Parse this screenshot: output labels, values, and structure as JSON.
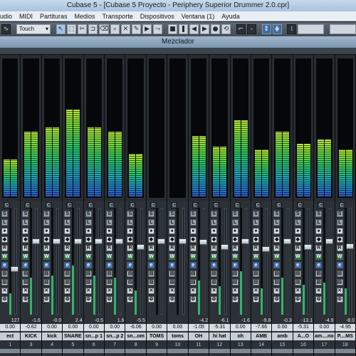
{
  "window": {
    "title": "Cubase 5 - [Cubase 5 Proyecto - Periphery Superior Drummer 2.0.cpr]"
  },
  "menu": [
    "udio",
    "MIDI",
    "Partituras",
    "Medios",
    "Transporte",
    "Dispositivos",
    "Ventana (1)",
    "Ayuda"
  ],
  "toolbar": {
    "automation_mode": "Touch",
    "tools": [
      "pointer-icon",
      "range-icon",
      "split-icon",
      "glue-icon",
      "erase-icon",
      "zoom-icon",
      "mute-icon",
      "draw-icon",
      "play-icon",
      "warp-icon"
    ],
    "transport": [
      "stop-icon",
      "rewind-icon",
      "forward-icon",
      "record-icon",
      "cycle-icon"
    ],
    "value_display": "-"
  },
  "mixer": {
    "title": "Mezclador",
    "channels": [
      {
        "name": "ect",
        "volume": "0.00",
        "peak": "127",
        "number": "1",
        "level": 0.27,
        "fader": 0.58
      },
      {
        "name": "KICK",
        "volume": "-0.62",
        "peak": "-1.6",
        "number": "3",
        "level": 0.47,
        "fader": 0.3
      },
      {
        "name": "kick",
        "volume": "0.00",
        "peak": "-0.0",
        "number": "4",
        "level": 0.5,
        "fader": 0.3
      },
      {
        "name": "SNARE",
        "volume": "0.00",
        "peak": "2.4",
        "number": "5",
        "level": 0.63,
        "fader": 0.3
      },
      {
        "name": "sn...p 1",
        "volume": "0.00",
        "peak": "-0.5",
        "number": "6",
        "level": 0.5,
        "fader": 0.3
      },
      {
        "name": "sn...p 2",
        "volume": "0.00",
        "peak": "1.6",
        "number": "7",
        "level": 0.47,
        "fader": 0.3
      },
      {
        "name": "sn...om",
        "volume": "-6.06",
        "peak": "-5.5",
        "number": "8",
        "level": 0.31,
        "fader": 0.36
      },
      {
        "name": "TOMS",
        "volume": "0.00",
        "peak": "",
        "number": "9",
        "level": 0.0,
        "fader": 0.3
      },
      {
        "name": "toms",
        "volume": "0.00",
        "peak": "",
        "number": "10",
        "level": 0.0,
        "fader": 0.3
      },
      {
        "name": "OH",
        "volume": "-1.05",
        "peak": "-4.2",
        "number": "11",
        "level": 0.44,
        "fader": 0.31
      },
      {
        "name": "hi hat",
        "volume": "-5.31",
        "peak": "-6.1",
        "number": "12",
        "level": 0.36,
        "fader": 0.36
      },
      {
        "name": "oh",
        "volume": "0.00",
        "peak": "-1.6",
        "number": "13",
        "level": 0.55,
        "fader": 0.3
      },
      {
        "name": "AMB",
        "volume": "-7.66",
        "peak": "-9.8",
        "number": "14",
        "level": 0.34,
        "fader": 0.38
      },
      {
        "name": "amb",
        "volume": "0.00",
        "peak": "-0.3",
        "number": "15",
        "level": 0.47,
        "fader": 0.3
      },
      {
        "name": "A...O",
        "volume": "-5.31",
        "peak": "-13.1",
        "number": "16",
        "level": 0.38,
        "fader": 0.36
      },
      {
        "name": "am....no",
        "volume": "0.00",
        "peak": "-4.9",
        "number": "17",
        "level": 0.41,
        "fader": 0.3
      },
      {
        "name": "P....MS",
        "volume": "-4.95",
        "peak": "-8.0",
        "number": "18",
        "level": 0.34,
        "fader": 0.35
      }
    ]
  },
  "colors": {
    "meter_low": "#2b58c8",
    "meter_mid": "#27c56a",
    "meter_high": "#b8e53b",
    "mixer_bg": "#15181b",
    "title_bar": "#a9c2dd"
  }
}
